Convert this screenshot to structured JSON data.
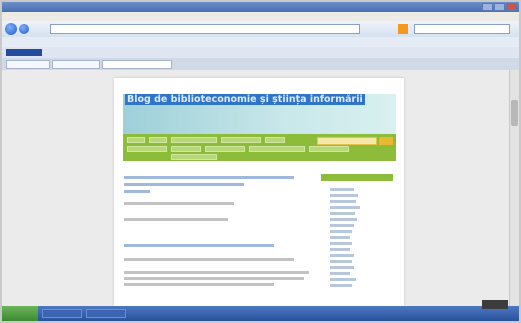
{
  "blog": {
    "title": "Blog de biblioteconomie și știința informării"
  },
  "colors": {
    "header_bg": "#c8e8ea",
    "nav_green": "#8dbb3a",
    "title_highlight": "#2e74c9",
    "link_blue": "#3a6fb0"
  },
  "icons": {
    "back": "back-icon",
    "forward": "forward-icon",
    "rss": "rss-icon",
    "start": "windows-start-icon"
  }
}
